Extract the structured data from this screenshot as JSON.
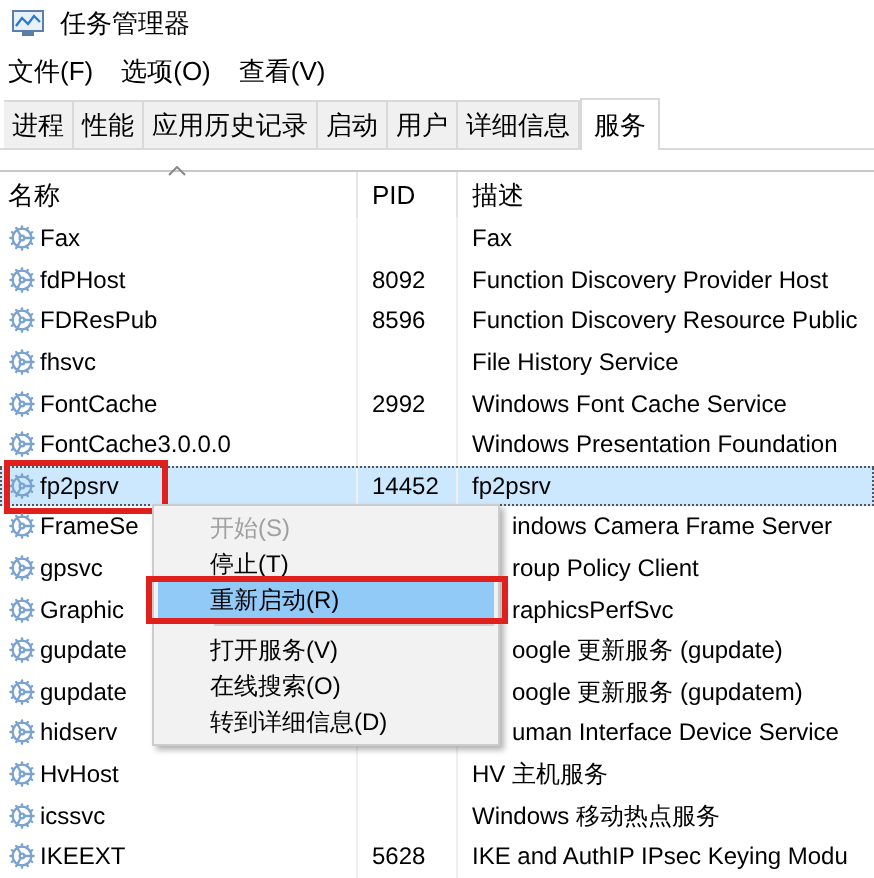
{
  "window": {
    "title": "任务管理器"
  },
  "menu_bar": [
    {
      "label": "文件(F)"
    },
    {
      "label": "选项(O)"
    },
    {
      "label": "查看(V)"
    }
  ],
  "tabs": [
    {
      "label": "进程",
      "selected": false
    },
    {
      "label": "性能",
      "selected": false
    },
    {
      "label": "应用历史记录",
      "selected": false
    },
    {
      "label": "启动",
      "selected": false
    },
    {
      "label": "用户",
      "selected": false
    },
    {
      "label": "详细信息",
      "selected": false
    },
    {
      "label": "服务",
      "selected": true
    }
  ],
  "table": {
    "columns": [
      "名称",
      "PID",
      "描述"
    ],
    "rows": [
      {
        "name": "Fax",
        "pid": "",
        "description": "Fax",
        "selected": false,
        "annotated": false,
        "covered": false
      },
      {
        "name": "fdPHost",
        "pid": "8092",
        "description": "Function Discovery Provider Host",
        "selected": false,
        "annotated": false,
        "covered": false
      },
      {
        "name": "FDResPub",
        "pid": "8596",
        "description": "Function Discovery Resource Public",
        "selected": false,
        "annotated": false,
        "covered": false
      },
      {
        "name": "fhsvc",
        "pid": "",
        "description": "File History Service",
        "selected": false,
        "annotated": false,
        "covered": false
      },
      {
        "name": "FontCache",
        "pid": "2992",
        "description": "Windows Font Cache Service",
        "selected": false,
        "annotated": false,
        "covered": false
      },
      {
        "name": "FontCache3.0.0.0",
        "pid": "",
        "description": "Windows Presentation Foundation",
        "selected": false,
        "annotated": false,
        "covered": false
      },
      {
        "name": "fp2psrv",
        "pid": "14452",
        "description": "fp2psrv",
        "selected": true,
        "annotated": true,
        "covered": false
      },
      {
        "name": "FrameSe",
        "pid": "",
        "description": "indows Camera Frame Server",
        "selected": false,
        "annotated": false,
        "covered": true
      },
      {
        "name": "gpsvc",
        "pid": "",
        "description": "roup Policy Client",
        "selected": false,
        "annotated": false,
        "covered": true
      },
      {
        "name": "Graphic",
        "pid": "",
        "description": "raphicsPerfSvc",
        "selected": false,
        "annotated": false,
        "covered": true
      },
      {
        "name": "gupdate",
        "pid": "",
        "description": "oogle 更新服务 (gupdate)",
        "selected": false,
        "annotated": false,
        "covered": true
      },
      {
        "name": "gupdate",
        "pid": "",
        "description": "oogle 更新服务 (gupdatem)",
        "selected": false,
        "annotated": false,
        "covered": true
      },
      {
        "name": "hidserv",
        "pid": "",
        "description": "uman Interface Device Service",
        "selected": false,
        "annotated": false,
        "covered": true
      },
      {
        "name": "HvHost",
        "pid": "",
        "description": "HV 主机服务",
        "selected": false,
        "annotated": false,
        "covered": false
      },
      {
        "name": "icssvc",
        "pid": "",
        "description": "Windows 移动热点服务",
        "selected": false,
        "annotated": false,
        "covered": false
      },
      {
        "name": "IKEEXT",
        "pid": "5628",
        "description": "IKE and AuthIP IPsec Keying Modu",
        "selected": false,
        "annotated": false,
        "covered": false
      }
    ]
  },
  "context_menu": [
    {
      "label": "开始(S)",
      "disabled": true,
      "selected": false,
      "annotated": false
    },
    {
      "label": "停止(T)",
      "disabled": false,
      "selected": false,
      "annotated": false
    },
    {
      "label": "重新启动(R)",
      "disabled": false,
      "selected": true,
      "annotated": true
    },
    {
      "kind": "separator"
    },
    {
      "label": "打开服务(V)",
      "disabled": false,
      "selected": false,
      "annotated": false
    },
    {
      "label": "在线搜索(O)",
      "disabled": false,
      "selected": false,
      "annotated": false
    },
    {
      "label": "转到详细信息(D)",
      "disabled": false,
      "selected": false,
      "annotated": false
    }
  ]
}
